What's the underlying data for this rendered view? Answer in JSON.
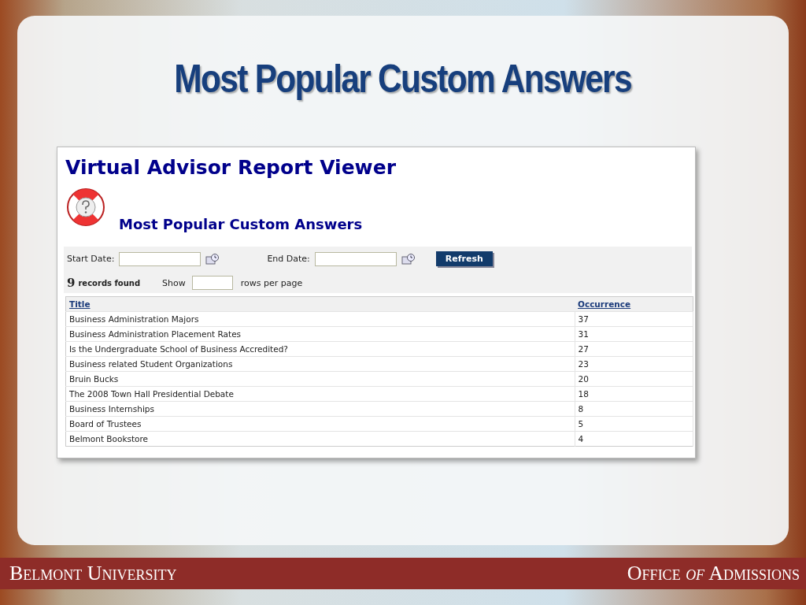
{
  "slide": {
    "title": "Most Popular Custom Answers"
  },
  "report": {
    "title": "Virtual Advisor Report Viewer",
    "subtitle": "Most Popular Custom Answers",
    "filters": {
      "start_label": "Start Date:",
      "end_label": "End Date:",
      "refresh": "Refresh"
    },
    "records_count": "9",
    "records_label": "records found",
    "show_label": "Show",
    "rows_label": "rows per page",
    "table": {
      "columns": [
        "Title",
        "Occurrence"
      ],
      "rows": [
        [
          "Business Administration Majors",
          "37"
        ],
        [
          "Business Administration Placement Rates",
          "31"
        ],
        [
          "Is the Undergraduate School of Business Accredited?",
          "27"
        ],
        [
          "Business related Student Organizations",
          "23"
        ],
        [
          "Bruin Bucks",
          "20"
        ],
        [
          "The 2008 Town Hall Presidential Debate",
          "18"
        ],
        [
          "Business Internships",
          "8"
        ],
        [
          "Board of Trustees",
          "5"
        ],
        [
          "Belmont Bookstore",
          "4"
        ]
      ]
    }
  },
  "footer": {
    "left": "Belmont University",
    "right": "Office *of* Admissions"
  }
}
